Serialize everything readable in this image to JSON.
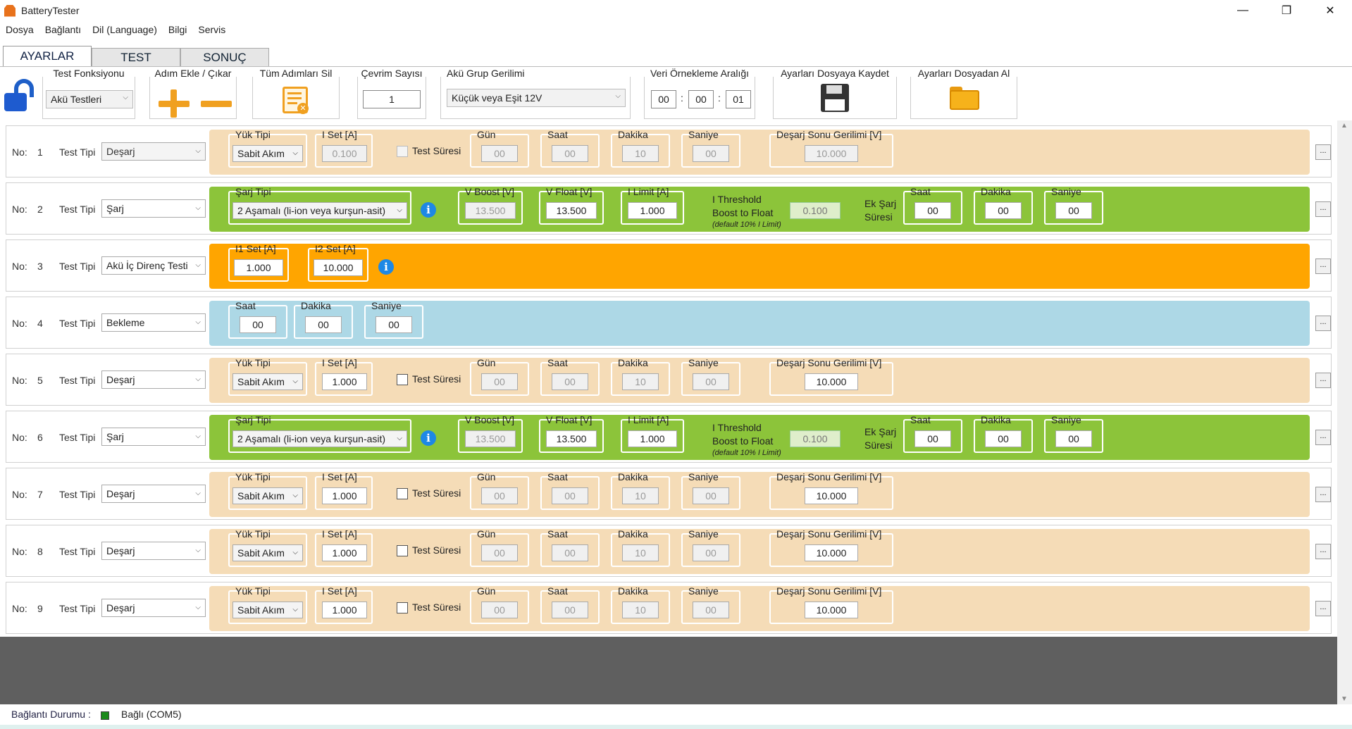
{
  "window": {
    "title": "BatteryTester",
    "minimize": "—",
    "maximize": "❐",
    "close": "✕"
  },
  "menu": [
    "Dosya",
    "Bağlantı",
    "Dil (Language)",
    "Bilgi",
    "Servis"
  ],
  "tabs": [
    "AYARLAR",
    "TEST",
    "SONUÇ"
  ],
  "toolbar": {
    "test_function": {
      "title": "Test Fonksiyonu",
      "value": "Akü Testleri"
    },
    "add_remove": {
      "title": "Adım Ekle / Çıkar"
    },
    "delete_all": {
      "title": "Tüm Adımları Sil"
    },
    "cycles": {
      "title": "Çevrim Sayısı",
      "value": "1"
    },
    "group_voltage": {
      "title": "Akü Grup Gerilimi",
      "value": "Küçük veya Eşit 12V"
    },
    "sampling": {
      "title": "Veri Örnekleme Aralığı",
      "h": "00",
      "m": "00",
      "s": "01",
      "sep": ":"
    },
    "save": {
      "title": "Ayarları Dosyaya Kaydet"
    },
    "load": {
      "title": "Ayarları Dosyadan Al"
    }
  },
  "labels": {
    "no": "No:",
    "test_type": "Test Tipi",
    "load_type": "Yük Tipi",
    "i_set": "I Set [A]",
    "test_duration": "Test Süresi",
    "day": "Gün",
    "hour": "Saat",
    "minute": "Dakika",
    "second": "Saniye",
    "end_voltage": "Deşarj Sonu Gerilimi [V]",
    "charge_type": "Şarj Tipi",
    "v_boost": "V Boost [V]",
    "v_float": "V Float [V]",
    "i_limit": "I Limit [A]",
    "threshold1": "I Threshold",
    "threshold2": "Boost to Float",
    "threshold3": "(default 10% I Limit)",
    "extra1": "Ek Şarj",
    "extra2": "Süresi",
    "i1": "I1 Set [A]",
    "i2": "I2 Set [A]",
    "more": "...",
    "info": "i"
  },
  "rows": [
    {
      "num": "1",
      "type": "Deşarj",
      "load": "Sabit Akım",
      "iset": "0.100",
      "day": "00",
      "hour": "00",
      "min": "10",
      "sec": "00",
      "vend": "10.000"
    },
    {
      "num": "2",
      "type": "Şarj",
      "charge": "2 Aşamalı (li-ion veya kurşun-asit)",
      "vboost": "13.500",
      "vfloat": "13.500",
      "ilimit": "1.000",
      "thr": "0.100",
      "eh": "00",
      "em": "00",
      "es": "00"
    },
    {
      "num": "3",
      "type": "Akü İç Direnç Testi",
      "i1": "1.000",
      "i2": "10.000"
    },
    {
      "num": "4",
      "type": "Bekleme",
      "h": "00",
      "m": "00",
      "s": "00"
    },
    {
      "num": "5",
      "type": "Deşarj",
      "load": "Sabit Akım",
      "iset": "1.000",
      "day": "00",
      "hour": "00",
      "min": "10",
      "sec": "00",
      "vend": "10.000"
    },
    {
      "num": "6",
      "type": "Şarj",
      "charge": "2 Aşamalı (li-ion veya kurşun-asit)",
      "vboost": "13.500",
      "vfloat": "13.500",
      "ilimit": "1.000",
      "thr": "0.100",
      "eh": "00",
      "em": "00",
      "es": "00"
    },
    {
      "num": "7",
      "type": "Deşarj",
      "load": "Sabit Akım",
      "iset": "1.000",
      "day": "00",
      "hour": "00",
      "min": "10",
      "sec": "00",
      "vend": "10.000"
    },
    {
      "num": "8",
      "type": "Deşarj",
      "load": "Sabit Akım",
      "iset": "1.000",
      "day": "00",
      "hour": "00",
      "min": "10",
      "sec": "00",
      "vend": "10.000"
    },
    {
      "num": "9",
      "type": "Deşarj",
      "load": "Sabit Akım",
      "iset": "1.000",
      "day": "00",
      "hour": "00",
      "min": "10",
      "sec": "00",
      "vend": "10.000"
    }
  ],
  "status": {
    "label": "Bağlantı Durumu :",
    "value": "Bağlı (COM5)"
  },
  "colors": {
    "discharge": "#f5dcb7",
    "charge": "#8cc43a",
    "resistance": "#ffa500",
    "wait": "#add8e6",
    "led": "#1a8a1a"
  }
}
